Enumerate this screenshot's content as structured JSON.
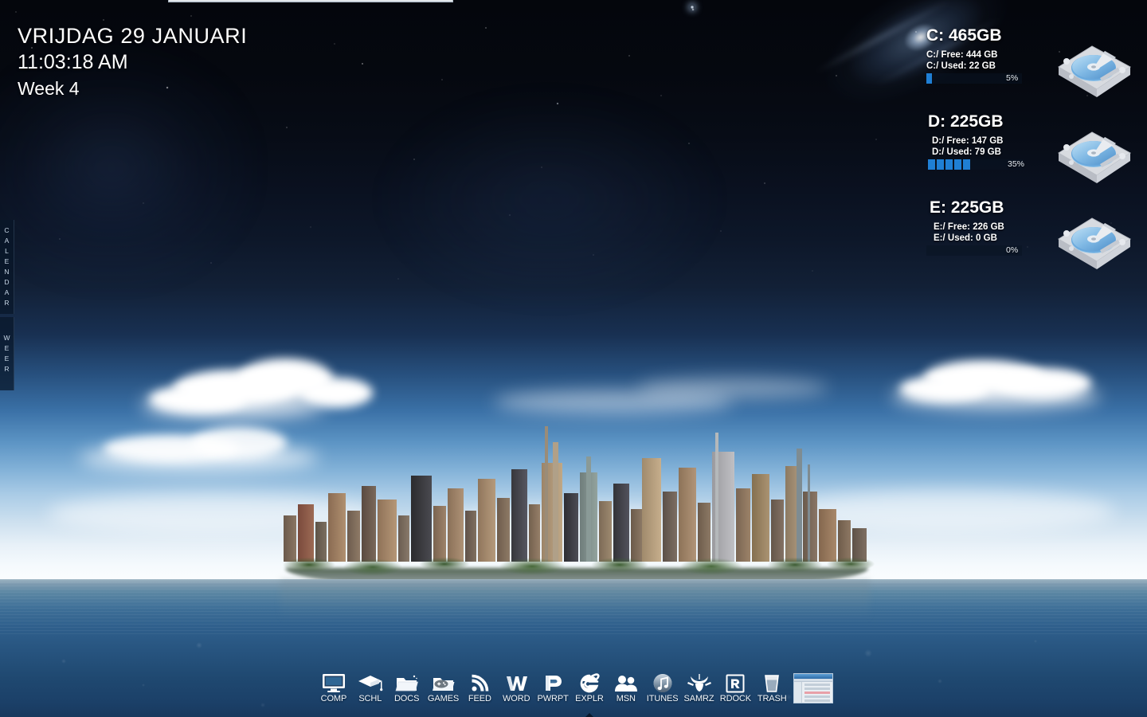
{
  "desktop": {
    "wallpaper_name": "floating-city-island-night-sky",
    "sky_top_color": "#04060c",
    "sky_horizon_color": "#fbfdfe",
    "water_color": "#27547f",
    "accent_color": "#1f7fd4"
  },
  "clock_widget": {
    "date": "VRIJDAG 29 JANUARI",
    "time": "11:03:18 AM",
    "week": "Week 4"
  },
  "sidebar_tabs": [
    {
      "name": "calendar",
      "label": "CALENDAR",
      "letters": [
        "C",
        "A",
        "L",
        "E",
        "N",
        "D",
        "A",
        "R"
      ]
    },
    {
      "name": "weer",
      "label": "WEER",
      "letters": [
        "W",
        "E",
        "E",
        "R"
      ]
    }
  ],
  "drives": [
    {
      "id": "c",
      "title": "C: 465GB",
      "free_line": "C:/ Free: 444 GB",
      "used_line": "C:/ Used: 22 GB",
      "percent_label": "5%",
      "percent": 5,
      "icon": "hard-drive-icon"
    },
    {
      "id": "d",
      "title": "D: 225GB",
      "free_line": "D:/ Free: 147 GB",
      "used_line": "D:/ Used: 79 GB",
      "percent_label": "35%",
      "percent": 35,
      "icon": "hard-drive-icon"
    },
    {
      "id": "e",
      "title": "E: 225GB",
      "free_line": "E:/ Free: 226 GB",
      "used_line": "E:/ Used: 0 GB",
      "percent_label": "0%",
      "percent": 0,
      "icon": "hard-drive-icon"
    }
  ],
  "dock": {
    "items": [
      {
        "label": "COMP",
        "icon": "monitor-icon",
        "running": false
      },
      {
        "label": "SCHL",
        "icon": "graduation-cap-icon",
        "running": false
      },
      {
        "label": "DOCS",
        "icon": "folder-icon",
        "running": false
      },
      {
        "label": "GAMES",
        "icon": "folder-gamepad-icon",
        "running": false
      },
      {
        "label": "FEED",
        "icon": "rss-icon",
        "running": false
      },
      {
        "label": "WORD",
        "icon": "word-w-icon",
        "running": false
      },
      {
        "label": "PWRPT",
        "icon": "powerpoint-p-icon",
        "running": false
      },
      {
        "label": "EXPLR",
        "icon": "internet-explorer-icon",
        "running": true
      },
      {
        "label": "MSN",
        "icon": "people-icon",
        "running": false
      },
      {
        "label": "ITUNES",
        "icon": "music-note-icon",
        "running": false
      },
      {
        "label": "SAMRZ",
        "icon": "samurai-mask-icon",
        "running": false
      },
      {
        "label": "RDOCK",
        "icon": "rocketdock-r-icon",
        "running": false
      },
      {
        "label": "TRASH",
        "icon": "trash-bin-icon",
        "running": false
      }
    ],
    "thumbnail": {
      "name": "window-thumbnail-preview"
    }
  }
}
